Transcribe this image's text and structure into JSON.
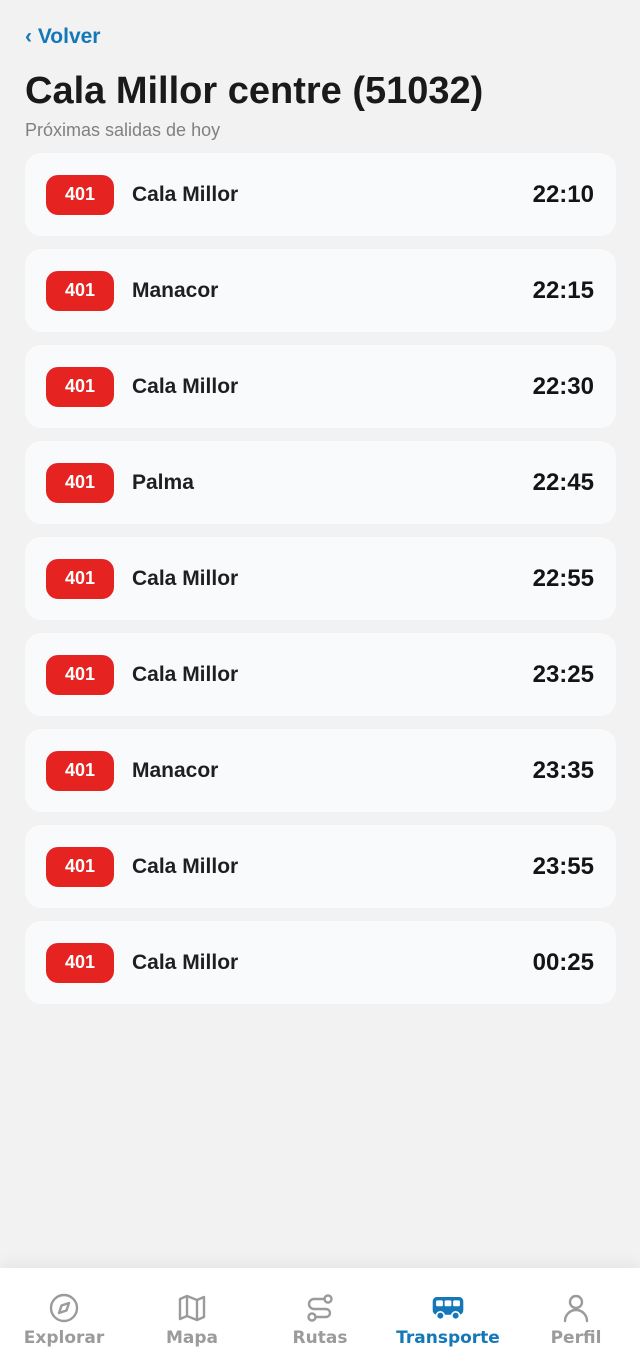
{
  "header": {
    "back_label": "‹ Volver",
    "title": "Cala Millor centre (51032)",
    "subtitle": "Próximas salidas de hoy"
  },
  "departures": [
    {
      "line": "401",
      "destination": "Cala Millor",
      "time": "22:10"
    },
    {
      "line": "401",
      "destination": "Manacor",
      "time": "22:15"
    },
    {
      "line": "401",
      "destination": "Cala Millor",
      "time": "22:30"
    },
    {
      "line": "401",
      "destination": "Palma",
      "time": "22:45"
    },
    {
      "line": "401",
      "destination": "Cala Millor",
      "time": "22:55"
    },
    {
      "line": "401",
      "destination": "Cala Millor",
      "time": "23:25"
    },
    {
      "line": "401",
      "destination": "Manacor",
      "time": "23:35"
    },
    {
      "line": "401",
      "destination": "Cala Millor",
      "time": "23:55"
    },
    {
      "line": "401",
      "destination": "Cala Millor",
      "time": "00:25"
    }
  ],
  "nav": {
    "items": [
      {
        "label": "Explorar",
        "icon": "compass-icon",
        "active": false
      },
      {
        "label": "Mapa",
        "icon": "map-icon",
        "active": false
      },
      {
        "label": "Rutas",
        "icon": "route-icon",
        "active": false
      },
      {
        "label": "Transporte",
        "icon": "bus-icon",
        "active": true
      },
      {
        "label": "Perfil",
        "icon": "user-icon",
        "active": false
      }
    ]
  },
  "colors": {
    "accent": "#1478b8",
    "line_badge": "#e52421",
    "inactive": "#9b9b9b",
    "background": "#f2f2f2",
    "card": "#f9fafb"
  }
}
